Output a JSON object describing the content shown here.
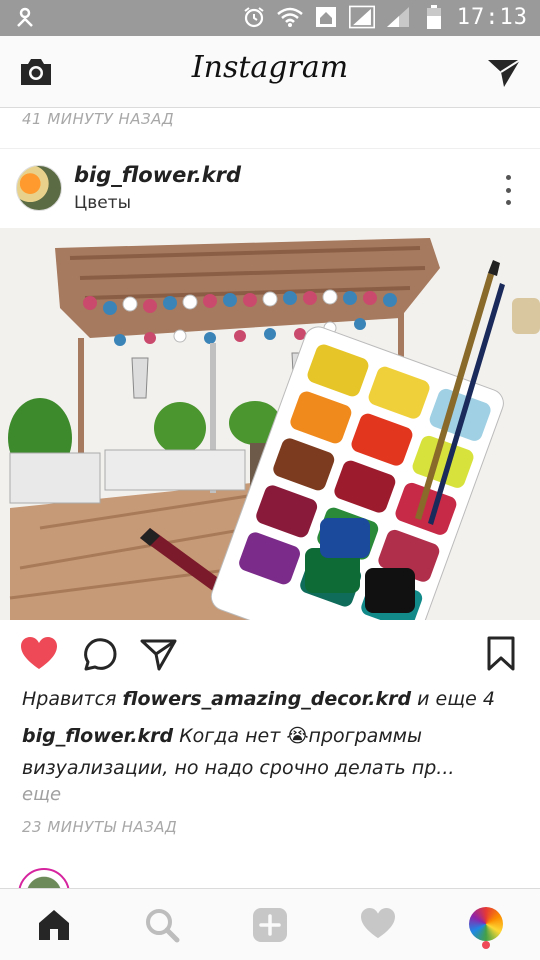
{
  "status_bar": {
    "time": "17:13",
    "icons": [
      "settings-icon",
      "alarm-icon",
      "wifi-icon",
      "home-icon",
      "signal-icon",
      "signal-icon",
      "battery-icon"
    ]
  },
  "header": {
    "title": "Instagram",
    "left_icon": "camera-icon",
    "right_icon": "direct-message-icon"
  },
  "previous_post": {
    "time": "41 МИНУТУ НАЗАД"
  },
  "post": {
    "username": "big_flower.krd",
    "location": "Цветы",
    "likes_prefix": "Нравится ",
    "likes_user": "flowers_amazing_decor.krd",
    "likes_suffix": " и еще 4",
    "caption_user": "big_flower.krd",
    "caption_text": " Когда нет 😭программы визуализации, но надо срочно делать пр...",
    "more": "еще",
    "time": "23 МИНУТЫ НАЗАД"
  },
  "actions": {
    "like_icon": "heart-filled-icon",
    "comment_icon": "comment-icon",
    "share_icon": "share-icon",
    "save_icon": "bookmark-icon",
    "like_color": "#ed4956"
  },
  "bottom_nav": {
    "items": [
      "home-icon",
      "search-icon",
      "add-post-icon",
      "activity-heart-icon",
      "profile-avatar"
    ]
  }
}
